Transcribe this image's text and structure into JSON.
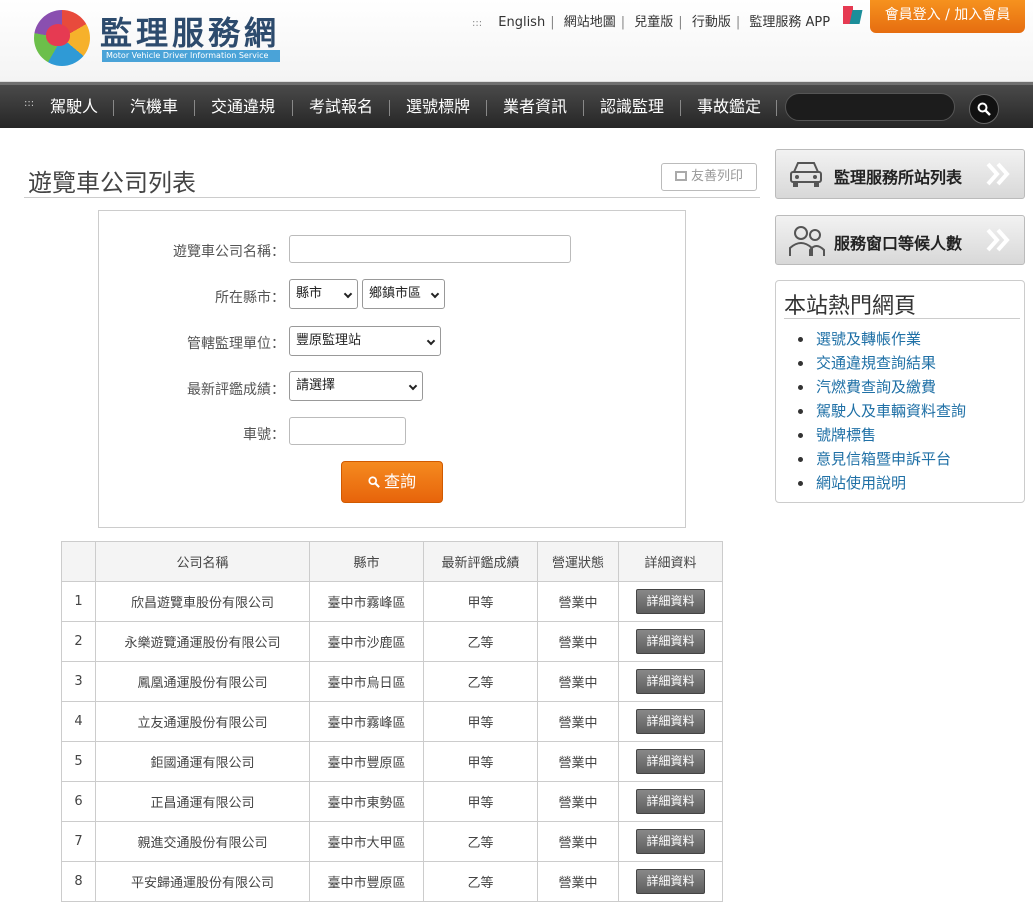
{
  "header": {
    "logo_title": "監理服務網",
    "logo_subtitle": "Motor Vehicle Driver Information Service",
    "top_links": [
      "English",
      "網站地圖",
      "兒童版",
      "行動版",
      "監理服務 APP"
    ],
    "login_label": "會員登入 / 加入會員"
  },
  "nav": {
    "items": [
      "駕駛人",
      "汽機車",
      "交通違規",
      "考試報名",
      "選號標牌",
      "業者資訊",
      "認識監理",
      "事故鑑定"
    ],
    "search_placeholder": ""
  },
  "page": {
    "title": "遊覽車公司列表",
    "print_label": "友善列印"
  },
  "form": {
    "company_label": "遊覽車公司名稱：",
    "company_value": "",
    "county_label": "所在縣市：",
    "county_select": "縣市",
    "district_select": "鄉鎮市區",
    "office_label": "管轄監理單位：",
    "office_select": "豐原監理站",
    "rating_label": "最新評鑑成績：",
    "rating_select": "請選擇",
    "plate_label": "車號：",
    "plate_value": "",
    "query_label": "查詢"
  },
  "table": {
    "headers": [
      "",
      "公司名稱",
      "縣市",
      "最新評鑑成績",
      "營運狀態",
      "詳細資料"
    ],
    "rows": [
      {
        "no": "1",
        "name": "欣昌遊覽車股份有限公司",
        "city": "臺中市霧峰區",
        "rating": "甲等",
        "status": "營業中",
        "detail": "詳細資料"
      },
      {
        "no": "2",
        "name": "永樂遊覽通運股份有限公司",
        "city": "臺中市沙鹿區",
        "rating": "乙等",
        "status": "營業中",
        "detail": "詳細資料"
      },
      {
        "no": "3",
        "name": "鳳凰通運股份有限公司",
        "city": "臺中市烏日區",
        "rating": "乙等",
        "status": "營業中",
        "detail": "詳細資料"
      },
      {
        "no": "4",
        "name": "立友通運股份有限公司",
        "city": "臺中市霧峰區",
        "rating": "甲等",
        "status": "營業中",
        "detail": "詳細資料"
      },
      {
        "no": "5",
        "name": "鉅國通運有限公司",
        "city": "臺中市豐原區",
        "rating": "甲等",
        "status": "營業中",
        "detail": "詳細資料"
      },
      {
        "no": "6",
        "name": "正昌通運有限公司",
        "city": "臺中市東勢區",
        "rating": "甲等",
        "status": "營業中",
        "detail": "詳細資料"
      },
      {
        "no": "7",
        "name": "親進交通股份有限公司",
        "city": "臺中市大甲區",
        "rating": "乙等",
        "status": "營業中",
        "detail": "詳細資料"
      },
      {
        "no": "8",
        "name": "平安歸通運股份有限公司",
        "city": "臺中市豐原區",
        "rating": "乙等",
        "status": "營業中",
        "detail": "詳細資料"
      }
    ]
  },
  "sidebar": {
    "station_list_label": "監理服務所站列表",
    "queue_label": "服務窗口等候人數",
    "hot_title": "本站熱門網頁",
    "hot_links": [
      "選號及轉帳作業",
      "交通違規查詢結果",
      "汽燃費查詢及繳費",
      "駕駛人及車輛資料查詢",
      "號牌標售",
      "意見信箱暨申訴平台",
      "網站使用說明"
    ]
  },
  "colors": {
    "accent_orange": "#f07a15",
    "nav_dark": "#2e2e2e",
    "link_blue": "#1f70a6"
  }
}
